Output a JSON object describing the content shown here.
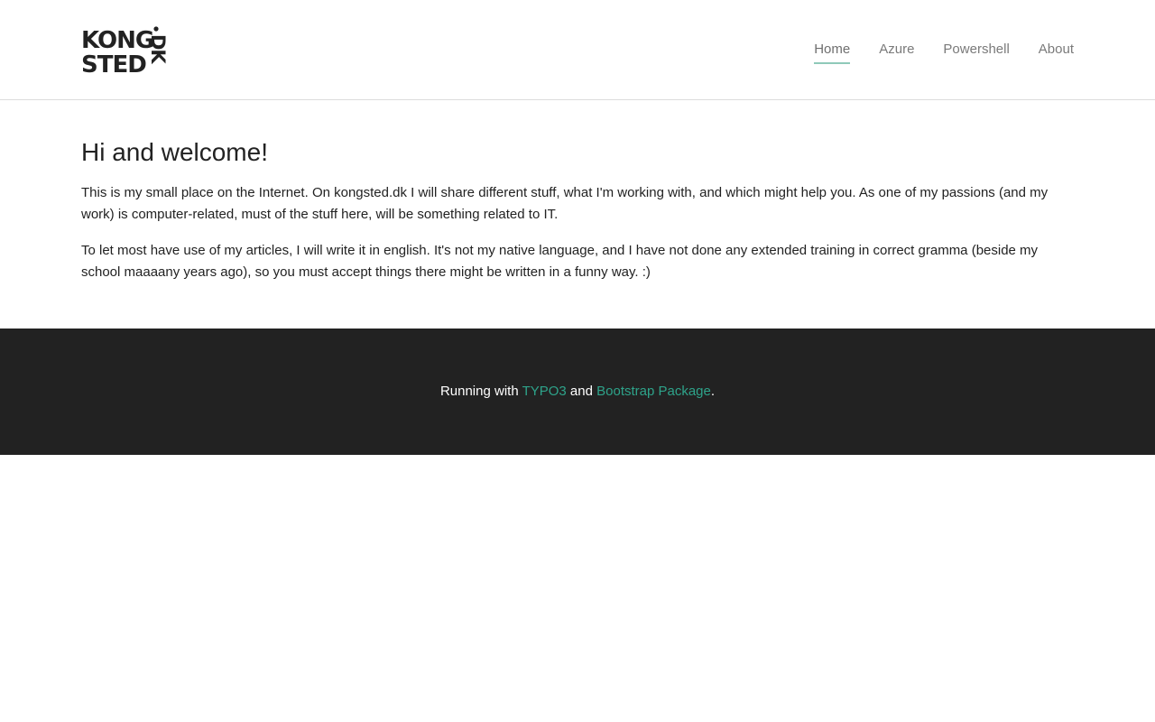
{
  "header": {
    "logo": {
      "line1": "KONG",
      "line2": "STED",
      "vertical": "DK"
    },
    "nav": [
      {
        "label": "Home",
        "active": true
      },
      {
        "label": "Azure",
        "active": false
      },
      {
        "label": "Powershell",
        "active": false
      },
      {
        "label": "About",
        "active": false
      }
    ]
  },
  "main": {
    "heading": "Hi and welcome!",
    "paragraphs": [
      "This is my small place on the Internet. On kongsted.dk I will share different stuff, what I'm working with, and which might help you. As one of my passions (and my work) is computer-related, must of the stuff here, will be something related to IT.",
      "To let most have use of my articles, I will write it in english. It's not my native language, and I have not done any extended training in correct gramma (beside my school maaaany years ago), so you must accept things there might be written in a funny way. :)"
    ]
  },
  "footer": {
    "prefix": "Running with ",
    "link1": "TYPO3",
    "middle": " and ",
    "link2": "Bootstrap Package",
    "suffix": "."
  },
  "colors": {
    "accent": "#2ea38a",
    "nav_underline": "#8fc9b9",
    "footer_bg": "#222222",
    "text": "#222222"
  }
}
